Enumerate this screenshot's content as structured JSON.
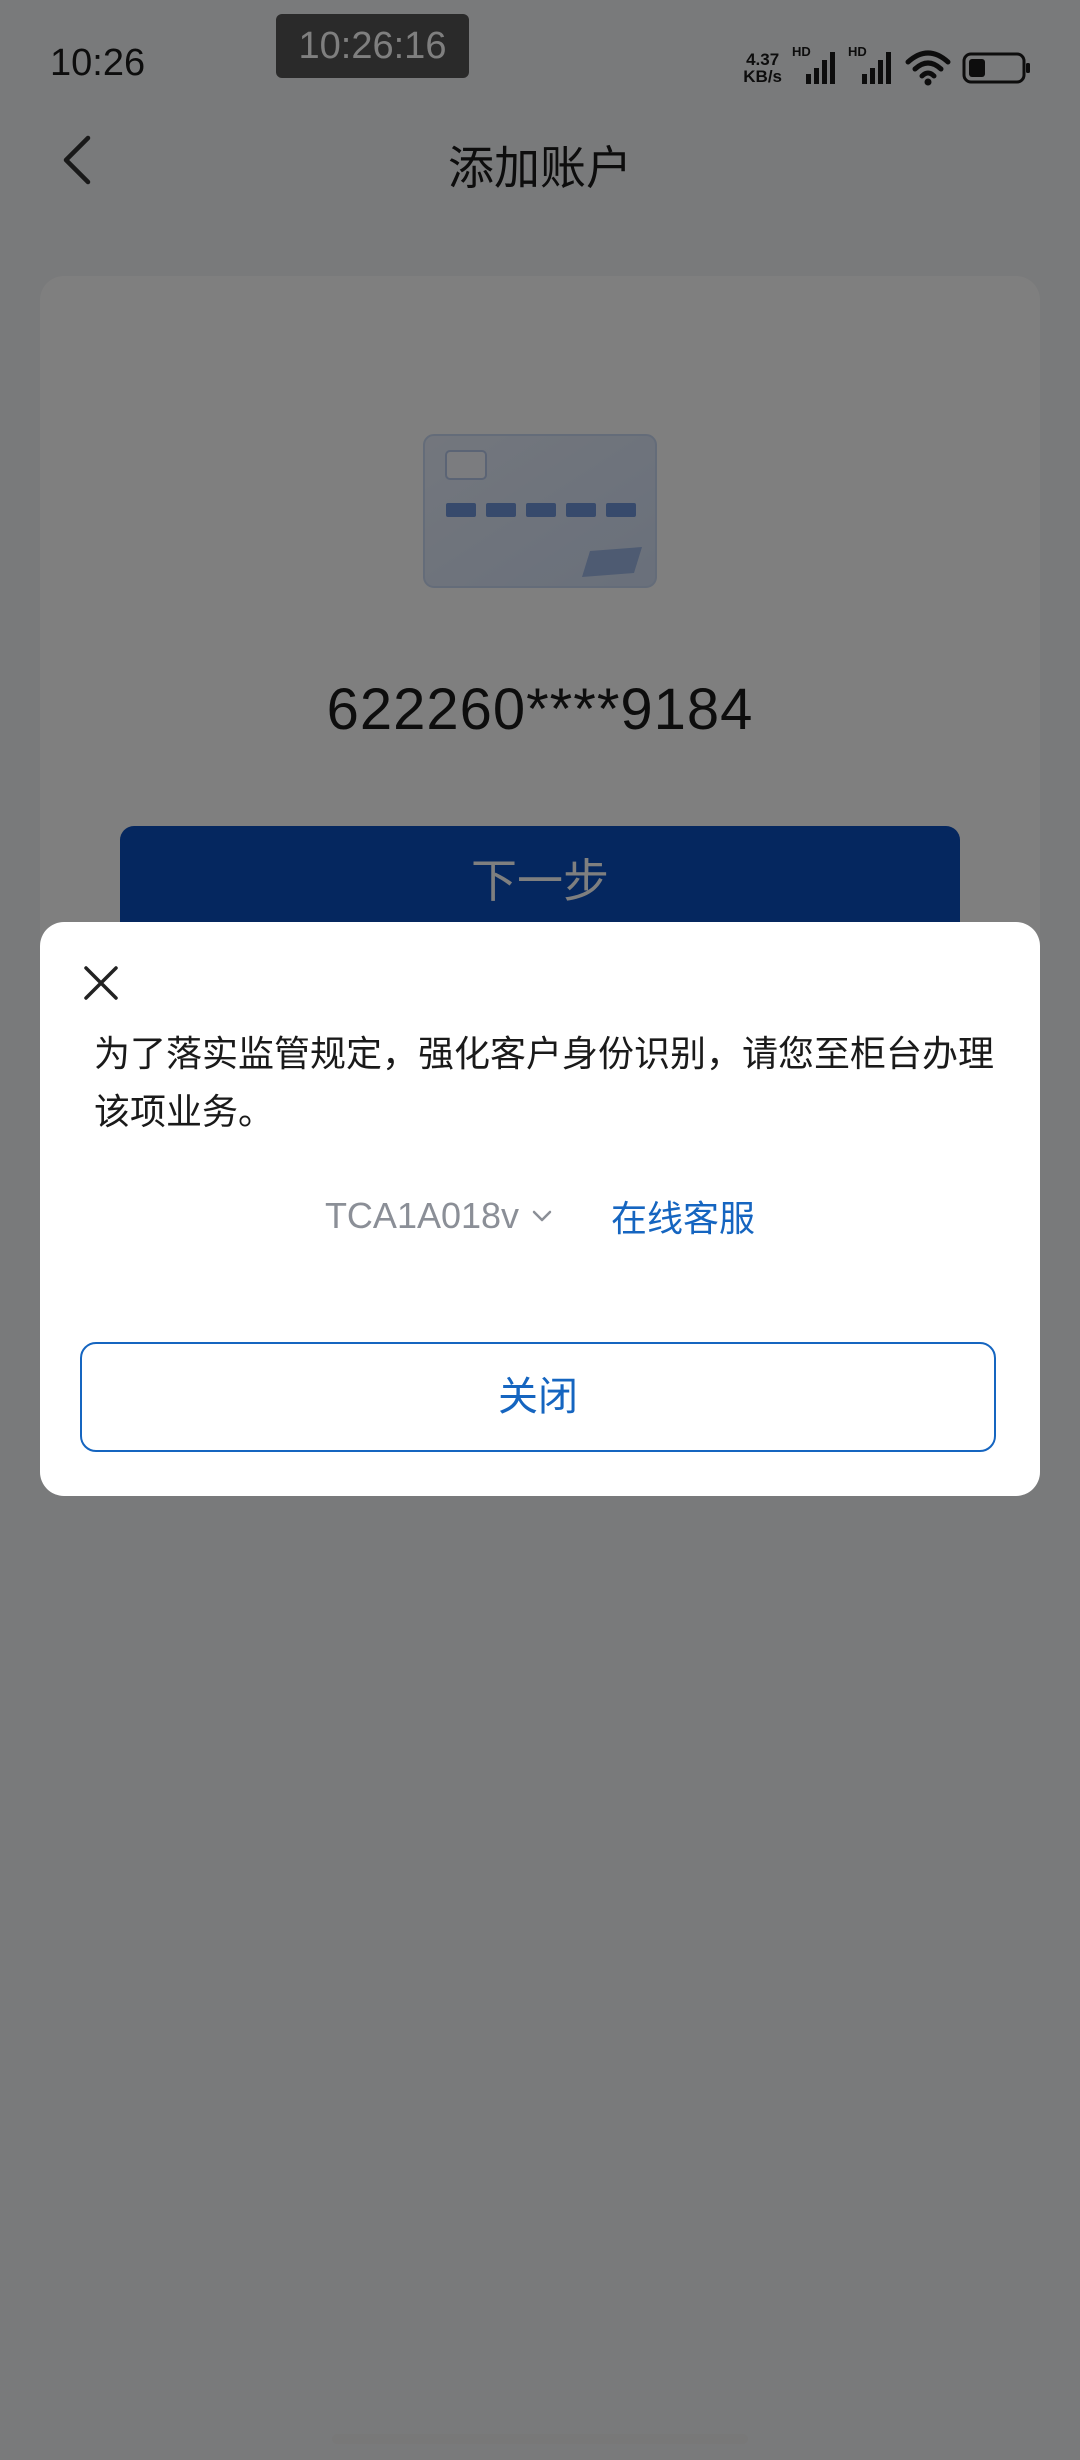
{
  "status_bar": {
    "time": "10:26",
    "screen_timer": "10:26:16",
    "net_speed_value": "4.37",
    "net_speed_unit": "KB/s",
    "signal_label_1": "HD",
    "signal_label_2": "HD",
    "icons": [
      "signal-icon",
      "signal-icon",
      "wifi-icon",
      "battery-icon"
    ]
  },
  "nav": {
    "title": "添加账户",
    "back_icon": "chevron-left-icon"
  },
  "card": {
    "number": "622260****9184",
    "illustration_icon": "bank-card-icon",
    "next_button_label": "下一步"
  },
  "dialog": {
    "message": "为了落实监管规定，强化客户身份识别，请您至柜台办理该项业务。",
    "error_code": "TCA1A018v",
    "online_service_label": "在线客服",
    "close_button_label": "关闭",
    "close_icon": "close-icon"
  },
  "colors": {
    "primary": "#0a4fbf",
    "link": "#1565c0",
    "overlay": "rgba(0,0,0,0.5)"
  }
}
